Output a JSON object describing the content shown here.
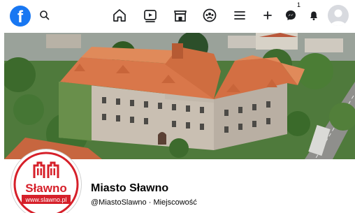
{
  "topbar": {
    "logo_letter": "f",
    "messenger_badge": "1"
  },
  "profile": {
    "name": "Miasto Sławno",
    "handle": "@MiastoSlawno",
    "separator": " · ",
    "category": "Miejscowość",
    "logo_text": "Sławno",
    "logo_url": "www.slawno.pl"
  },
  "colors": {
    "brand_blue": "#1877f2",
    "logo_red": "#d6202a",
    "roof": "#d9774a",
    "facade": "#c9bfb2"
  }
}
